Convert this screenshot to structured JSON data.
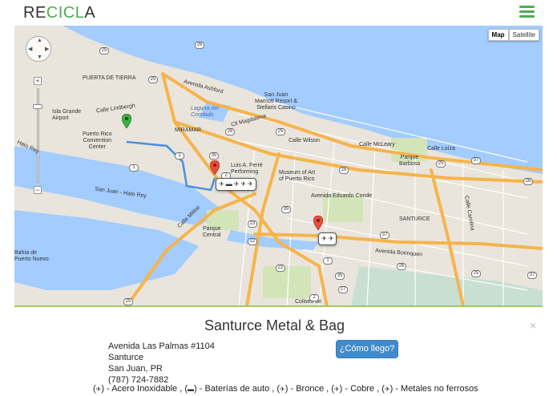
{
  "header": {
    "logo": {
      "part1": "RE",
      "part2": "CICL",
      "part3": "A"
    },
    "menu_icon": "hamburger-icon"
  },
  "map": {
    "type_buttons": [
      "Map",
      "Satellite"
    ],
    "zoom_plus": "+",
    "zoom_minus": "−",
    "labels": {
      "avenida_ashford": "Avenida Ashford",
      "puerta_de_tierra": "PUERTA DE TIERRA",
      "isla_grande": "Isla Grande\nAirport",
      "calle_lindbergh": "Calle Lindbergh",
      "convention": "Puerto Rico\nConvention\nCenter",
      "laguna": "Laguna del\nCondado",
      "san_juan_marriott": "San Juan\nMarriott Resort &\nStellaris Casino",
      "miramar": "MIRAMAR",
      "cll_magdalena": "Cll Magdalena",
      "calle_wilson": "Calle Wilson",
      "calle_mcleary": "Calle McLeary",
      "calle_loiza": "Calle Loíza",
      "parque_barbosa": "Parque\nBarbosa",
      "hato_rey": "Hato Rey",
      "luis_ferre": "Luis A. Ferré\nPerforming",
      "museum": "Museum of Art\nof Puerto Rico",
      "avenida_eduardo_conde": "Avenida Eduardo Conde",
      "san_juan_hato_rey": "San Juan - Hato Rey",
      "santurce": "SANTURCE",
      "parque_central": "Parque\nCentral",
      "calle_militar": "Calle Militar",
      "bahia": "Bahía de\nPuerto Nuevo",
      "avenida_borinquen": "Avenida Borinquen",
      "coliseo": "Coliseo de",
      "calle_carolina": "Calle Carolina"
    },
    "shields": [
      "25",
      "25",
      "1",
      "35",
      "26",
      "25",
      "37",
      "2",
      "1",
      "26",
      "25",
      "26",
      "35",
      "23",
      "37",
      "22",
      "1",
      "35",
      "26",
      "25",
      "37",
      "26",
      "2",
      "22",
      "25",
      "27"
    ]
  },
  "detail": {
    "title": "Santurce Metal & Bag",
    "address_line1": "Avenida Las Palmas #1104",
    "address_line2": "Santurce",
    "address_line3": "San Juan, PR",
    "phone": "(787) 724-7882",
    "directions_button": "¿Cómo llego?",
    "close": "×",
    "materials_text": "( ) - Acero Inoxidable , ( ) - Baterías de auto , ( ) - Bronce , ( ) - Cobre , ( ) - Metales no ferrosos",
    "materials": [
      {
        "label": "Acero Inoxidable",
        "icon": "stainless-steel-icon"
      },
      {
        "label": "Baterías de auto",
        "icon": "car-battery-icon"
      },
      {
        "label": "Bronce",
        "icon": "bronze-icon"
      },
      {
        "label": "Cobre",
        "icon": "copper-icon"
      },
      {
        "label": "Metales no ferrosos",
        "icon": "non-ferrous-metal-icon"
      }
    ]
  },
  "colors": {
    "accent": "#4cae4c",
    "button": "#428bca",
    "water": "#a3ccff",
    "land": "#e9e5dc",
    "highway": "#f6b44c"
  }
}
